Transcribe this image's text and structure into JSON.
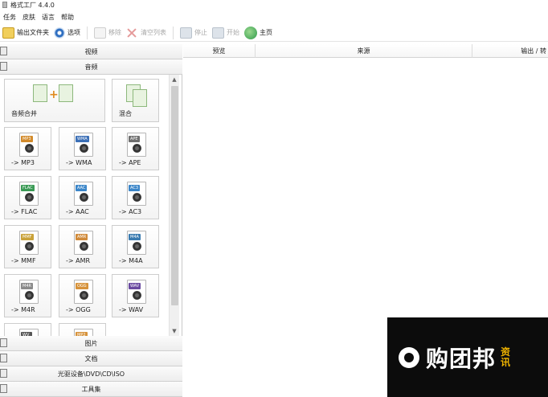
{
  "app": {
    "title": "格式工厂 4.4.0"
  },
  "menubar": {
    "items": [
      "任务",
      "皮肤",
      "语言",
      "帮助"
    ]
  },
  "toolbar": {
    "output_folder": "输出文件夹",
    "options": "选项",
    "remove": "移除",
    "clear_list": "清空列表",
    "stop": "停止",
    "start": "开始",
    "home": "主页"
  },
  "categories": {
    "video": "视频",
    "audio": "音频",
    "picture": "图片",
    "document": "文档",
    "optical": "光驱设备\\DVD\\CD\\ISO",
    "tools": "工具集"
  },
  "audio_tiles": [
    {
      "label": "音频合并",
      "icon": "audio-merge-icon"
    },
    {
      "label": "混合",
      "icon": "audio-mix-icon"
    },
    {
      "label": "-> MP3",
      "tag": "MP3",
      "tag_color": "#d28a2a"
    },
    {
      "label": "-> WMA",
      "tag": "WMA",
      "tag_color": "#3b6fb6"
    },
    {
      "label": "-> APE",
      "tag": "APE",
      "tag_color": "#6f6f6f"
    },
    {
      "label": "-> FLAC",
      "tag": "FLAC",
      "tag_color": "#3a9a55"
    },
    {
      "label": "-> AAC",
      "tag": "AAC",
      "tag_color": "#3b86c9"
    },
    {
      "label": "-> AC3",
      "tag": "AC3",
      "tag_color": "#3b86c9"
    },
    {
      "label": "-> MMF",
      "tag": "MMF",
      "tag_color": "#c9a23a"
    },
    {
      "label": "-> AMR",
      "tag": "AMR",
      "tag_color": "#d08a3a"
    },
    {
      "label": "-> M4A",
      "tag": "M4A",
      "tag_color": "#3a7bb0"
    },
    {
      "label": "-> M4R",
      "tag": "M4R",
      "tag_color": "#8a8a8a"
    },
    {
      "label": "-> OGG",
      "tag": "OGG",
      "tag_color": "#d6923a"
    },
    {
      "label": "-> WAV",
      "tag": "WAV",
      "tag_color": "#6a4aa0"
    },
    {
      "label": "",
      "tag": "WV",
      "tag_color": "#555555"
    },
    {
      "label": "",
      "tag": "MP2",
      "tag_color": "#d6923a"
    }
  ],
  "table": {
    "columns": [
      "预览",
      "来源",
      "输出 / 转"
    ]
  },
  "watermark": {
    "text": "购团邦",
    "sub": [
      "资",
      "讯"
    ]
  }
}
